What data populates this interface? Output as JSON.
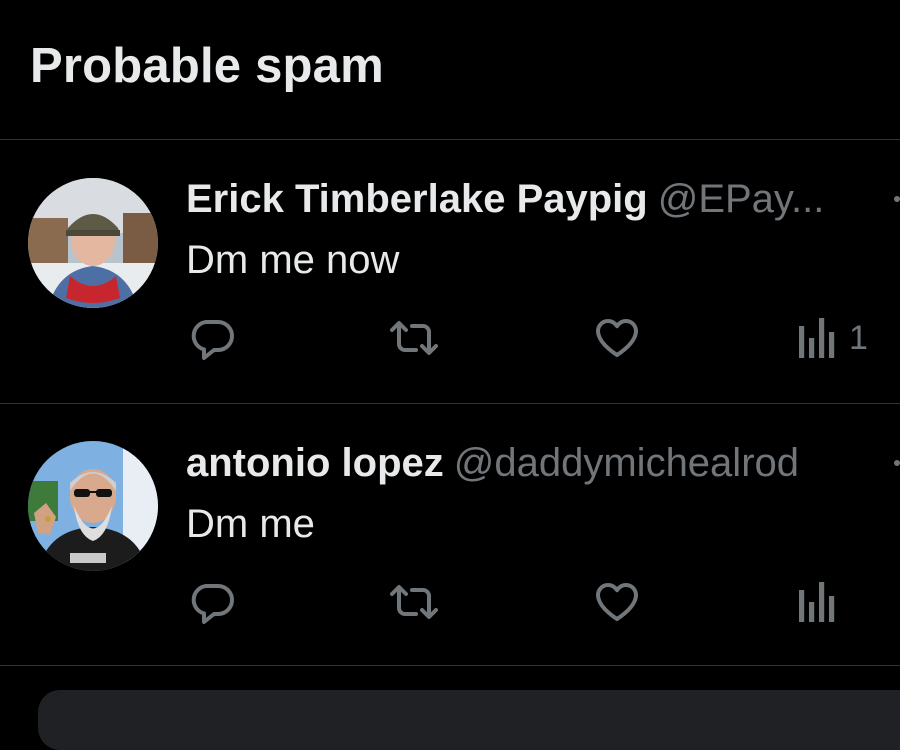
{
  "section": {
    "title": "Probable spam"
  },
  "tweets": [
    {
      "display_name": "Erick Timberlake Paypig",
      "handle": "@EPay...",
      "text": "Dm me now",
      "views": "1",
      "avatar": "avatar-photo-man-cap-red-hoodie"
    },
    {
      "display_name": "antonio lopez",
      "handle": "@daddymichealrod",
      "text": "Dm me",
      "views": "",
      "avatar": "avatar-photo-man-sunglasses-beard"
    }
  ],
  "icons": {
    "reply": "reply-icon",
    "retweet": "retweet-icon",
    "like": "like-icon",
    "views": "views-icon",
    "more": "more-icon"
  },
  "colors": {
    "background": "#000000",
    "text_primary": "#e7e9ea",
    "text_secondary": "#71767b",
    "divider": "#2f3336"
  }
}
